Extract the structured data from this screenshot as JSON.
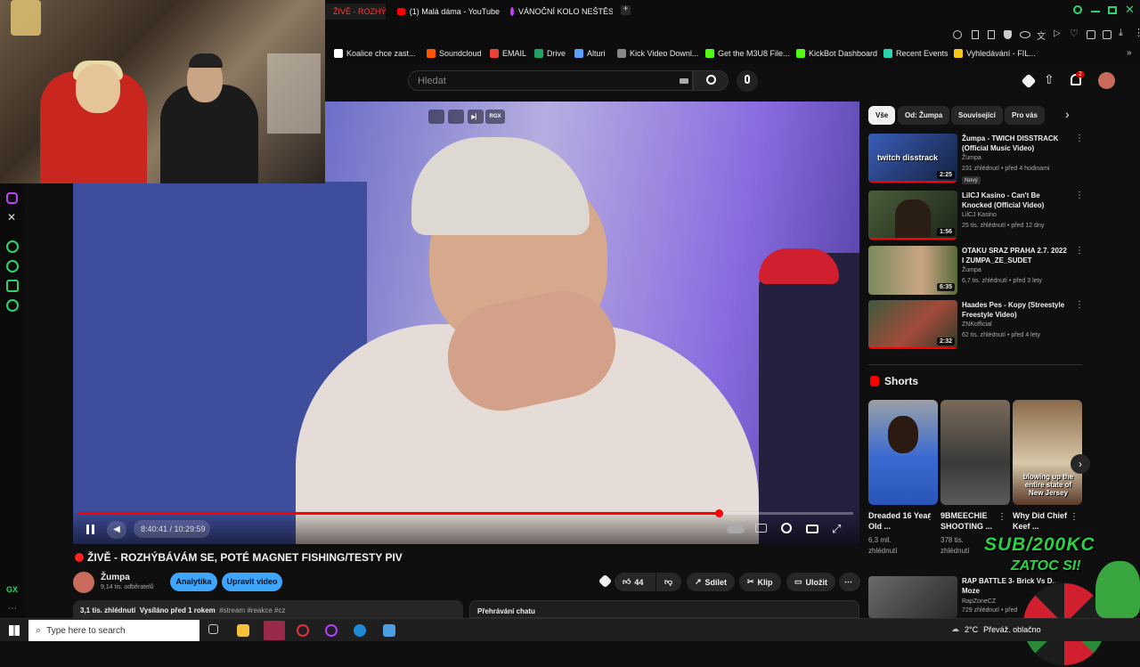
{
  "browser": {
    "tabs": [
      {
        "label": "ŽIVĚ - ROZHÝBÁ",
        "icon": "youtube-icon",
        "active": true
      },
      {
        "label": "(1) Malá dáma - YouTube",
        "icon": "youtube-icon",
        "active": false
      },
      {
        "label": "VÁNOČNÍ KOLO NEŠTĚSTÍ",
        "icon": "gx-icon",
        "active": false
      }
    ],
    "new_tab_label": "+",
    "bookmarks": [
      {
        "label": "Koalice chce zast...",
        "color": "#ffffff"
      },
      {
        "label": "Soundcloud",
        "color": "#ff5500"
      },
      {
        "label": "EMAIL",
        "color": "#ea4335"
      },
      {
        "label": "Drive",
        "color": "#1fa463"
      },
      {
        "label": "Alturi",
        "color": "#5aa0ff"
      },
      {
        "label": "Kick Video Downl...",
        "color": "#888888"
      },
      {
        "label": "Get the M3U8 File...",
        "color": "#53fc18"
      },
      {
        "label": "KickBot Dashboard",
        "color": "#53fc18"
      },
      {
        "label": "Recent Events",
        "color": "#2ad4b0"
      },
      {
        "label": "Vyhledávání - FIL...",
        "color": "#f5c518"
      }
    ],
    "gx_label": "GX"
  },
  "youtube": {
    "search_placeholder": "Hledat",
    "notif_count": "2",
    "video": {
      "time": "8:40:41 / 10:29:59",
      "progress": 0.826,
      "title": "ŽIVĚ - ROZHÝBÁVÁM SE, POTÉ MAGNET FISHING/TESTY PIV",
      "top_badge": "RGX"
    },
    "channel": {
      "name": "Žumpa",
      "subs": "9,14 tis. odběratelů"
    },
    "buttons": {
      "analytics": "Analytika",
      "edit": "Upravit video",
      "likes": "44",
      "share": "Sdílet",
      "clip": "Klip",
      "save": "Uložit",
      "more": "⋯"
    },
    "description": {
      "views": "3,1 tis. zhlédnutí",
      "aired": "Vysíláno před 1 rokem",
      "tags": "#stream #reakce #cz"
    },
    "chat_label": "Přehrávání chatu",
    "chips": [
      "Vše",
      "Od: Žumpa",
      "Související",
      "Pro vás"
    ],
    "recommended": [
      {
        "title": "Žumpa - TWICH DISSTRACK (Official Music Video)",
        "channel": "Žumpa",
        "meta": "231 zhlédnutí • před 4 hodinami",
        "badge": "Nový",
        "duration": "2:25",
        "thumb_color": "#2b3c6b",
        "thumb_text": "twitch disstrack"
      },
      {
        "title": "LilCJ Kasino - Can't Be Knocked (Official Video)",
        "channel": "LilCJ Kasino",
        "meta": "25 tis. zhlédnutí • před 12 dny",
        "badge": "",
        "duration": "1:56",
        "thumb_color": "#2e3a26",
        "thumb_text": ""
      },
      {
        "title": "OTAKU SRAZ PRAHA 2.7. 2022 I ZUMPA_ZE_SUDET",
        "channel": "Žumpa",
        "meta": "6,7 tis. zhlédnutí • před 3 lety",
        "badge": "",
        "duration": "6:35",
        "thumb_color": "#6a7a4a",
        "thumb_text": ""
      },
      {
        "title": "Haades Pes - Kopy (Streestyle Freestyle Video)",
        "channel": "ZNKofficial",
        "meta": "62 tis. zhlédnutí • před 4 lety",
        "badge": "",
        "duration": "2:32",
        "thumb_color": "#3a4a3a",
        "thumb_text": ""
      },
      {
        "title": "RAP BATTLE 3- Brick Vs D... Moze",
        "channel": "RapZoneCZ",
        "meta": "729 zhlédnutí • před",
        "badge": "",
        "duration": "",
        "thumb_color": "#505050",
        "thumb_text": ""
      }
    ],
    "shorts_label": "Shorts",
    "shorts": [
      {
        "title": "Dreaded 16 Year Old ...",
        "views": "6,3 mil. zhlédnutí",
        "color": "#2a4a8a",
        "caption": ""
      },
      {
        "title": "9BMEECHIE SHOOTING ...",
        "views": "378 tis. zhlédnutí",
        "color": "#4a4a4a",
        "caption": ""
      },
      {
        "title": "Why Did Chief Keef ...",
        "views": "",
        "color": "#6a4a2a",
        "caption": "blowing up the entire state of New Jersey"
      }
    ]
  },
  "overlay": {
    "line1": "SUB/200KC",
    "line2": "ZATOC SI!"
  },
  "taskbar": {
    "search_placeholder": "Type here to search",
    "weather": "2°C",
    "weather_desc": "Převáž. oblačno"
  }
}
